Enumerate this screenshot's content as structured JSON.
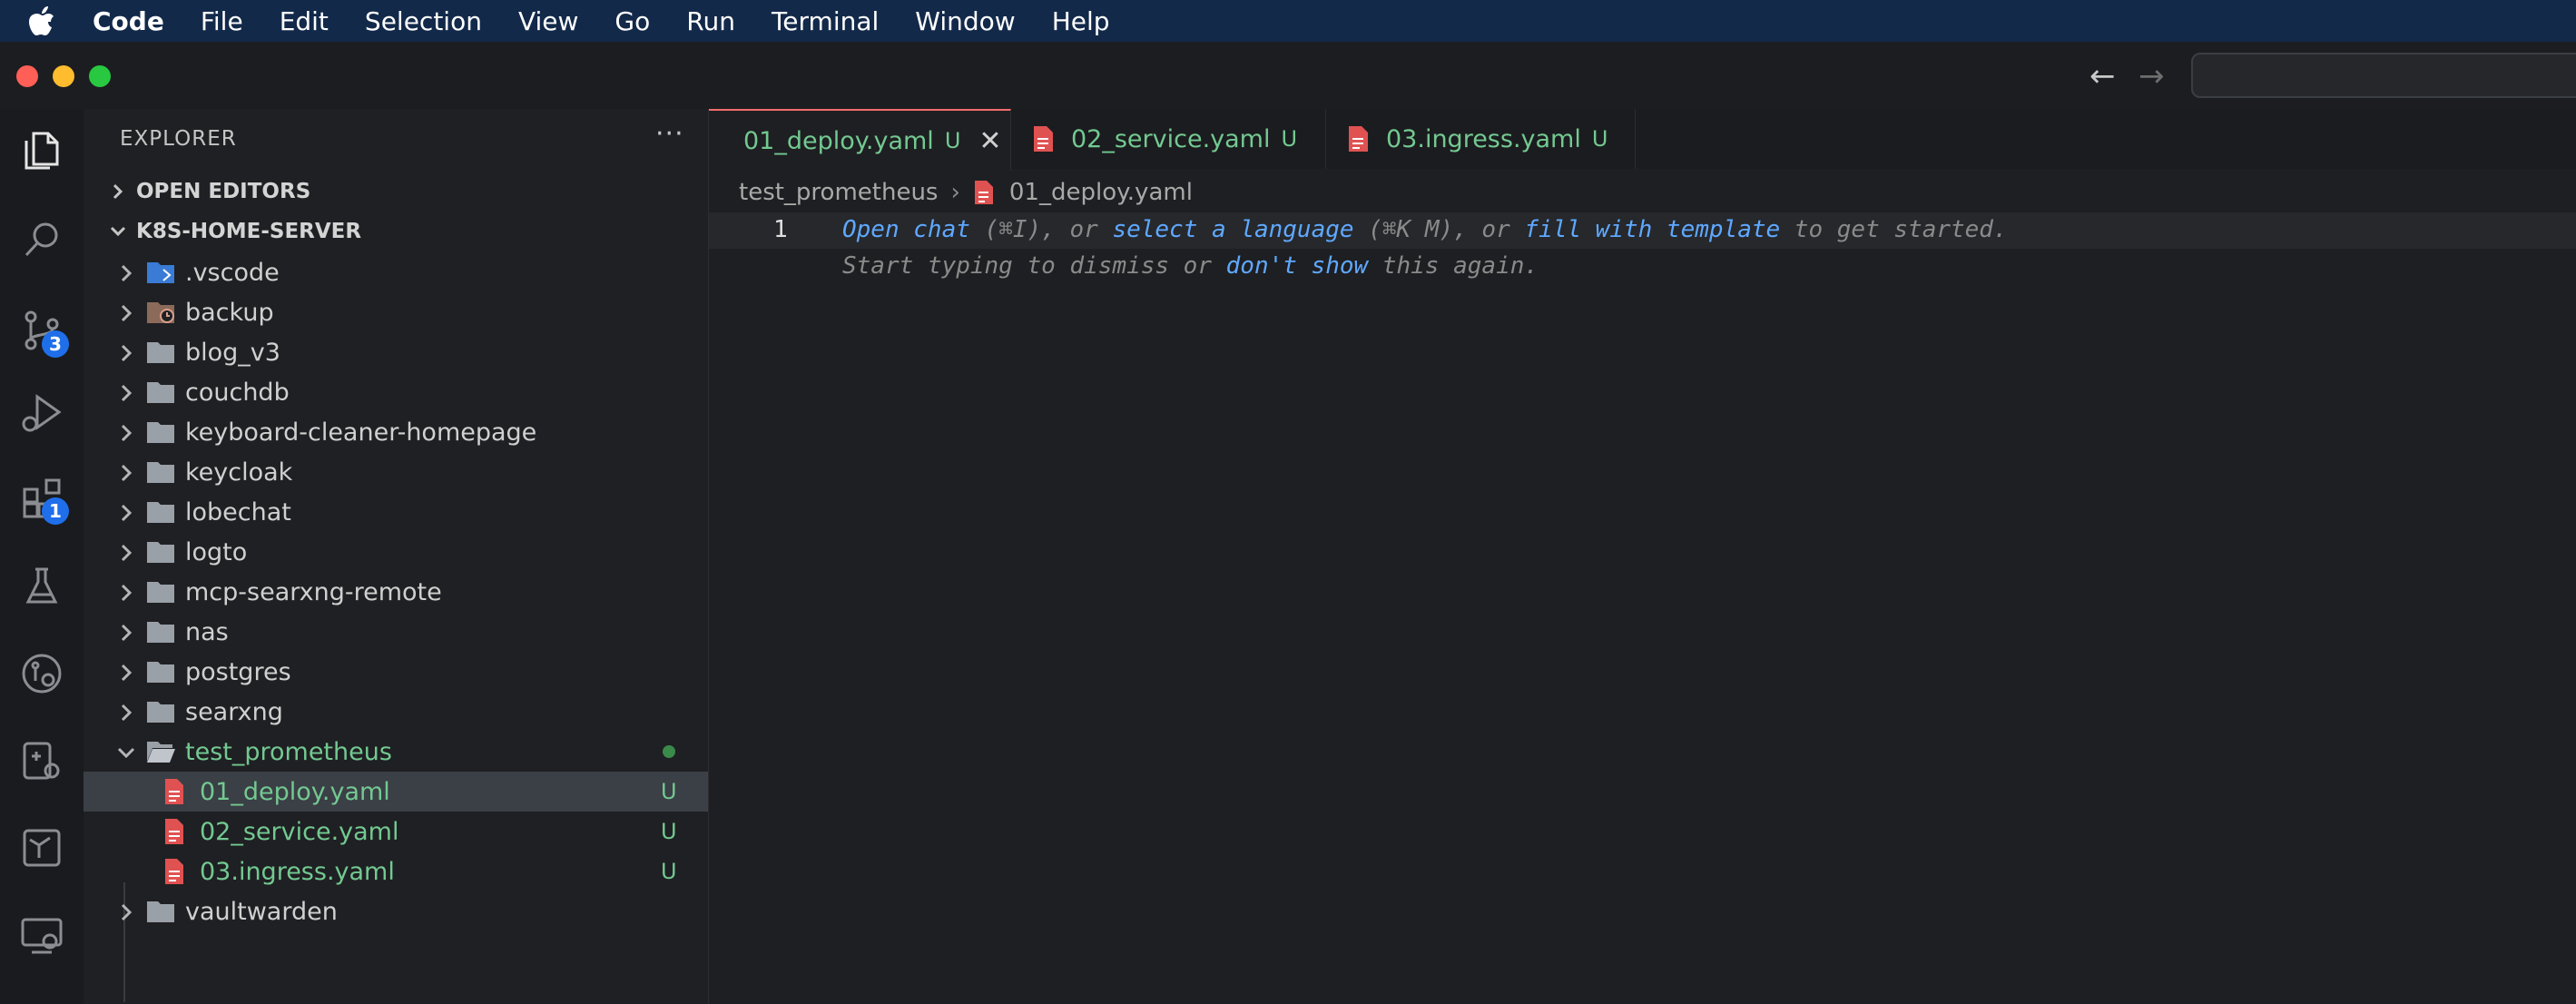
{
  "menubar": {
    "app": "Code",
    "items": [
      "File",
      "Edit",
      "Selection",
      "View",
      "Go",
      "Run",
      "Terminal",
      "Window",
      "Help"
    ]
  },
  "activity": {
    "icons": [
      "files-icon",
      "search-icon",
      "source-control-icon",
      "run-debug-icon",
      "extensions-icon",
      "testing-icon",
      "git-graph-icon",
      "docker-icon",
      "kubernetes-icon",
      "remote-explorer-icon"
    ],
    "source_control_badge": "3",
    "extensions_badge": "1"
  },
  "sidebar": {
    "title": "EXPLORER",
    "more": "···",
    "open_editors": "OPEN EDITORS",
    "workspace": "K8S-HOME-SERVER",
    "items": [
      {
        "label": ".vscode"
      },
      {
        "label": "backup"
      },
      {
        "label": "blog_v3"
      },
      {
        "label": "couchdb"
      },
      {
        "label": "keyboard-cleaner-homepage"
      },
      {
        "label": "keycloak"
      },
      {
        "label": "lobechat"
      },
      {
        "label": "logto"
      },
      {
        "label": "mcp-searxng-remote"
      },
      {
        "label": "nas"
      },
      {
        "label": "postgres"
      },
      {
        "label": "searxng"
      },
      {
        "label": "test_prometheus"
      },
      {
        "label": "01_deploy.yaml",
        "status": "U"
      },
      {
        "label": "02_service.yaml",
        "status": "U"
      },
      {
        "label": "03.ingress.yaml",
        "status": "U"
      },
      {
        "label": "vaultwarden"
      }
    ]
  },
  "tabs": [
    {
      "label": "01_deploy.yaml",
      "status": "U",
      "close": "✕"
    },
    {
      "label": "02_service.yaml",
      "status": "U"
    },
    {
      "label": "03.ingress.yaml",
      "status": "U"
    }
  ],
  "breadcrumb": {
    "folder": "test_prometheus",
    "file": "01_deploy.yaml"
  },
  "editor": {
    "line_number": "1",
    "hint1": {
      "open_chat": "Open chat",
      "t1": " (⌘I), or ",
      "select_language": "select a language",
      "t2": " (⌘K M), or ",
      "fill_template": "fill with template",
      "t3": " to get started."
    },
    "hint2": {
      "t1": "Start typing to dismiss or ",
      "dont_show": "don't show",
      "t2": " this again."
    }
  },
  "colors": {
    "accent_tab": "#f26d6d",
    "untracked": "#73c991",
    "link": "#5fa8ff",
    "badge": "#1f6feb"
  }
}
